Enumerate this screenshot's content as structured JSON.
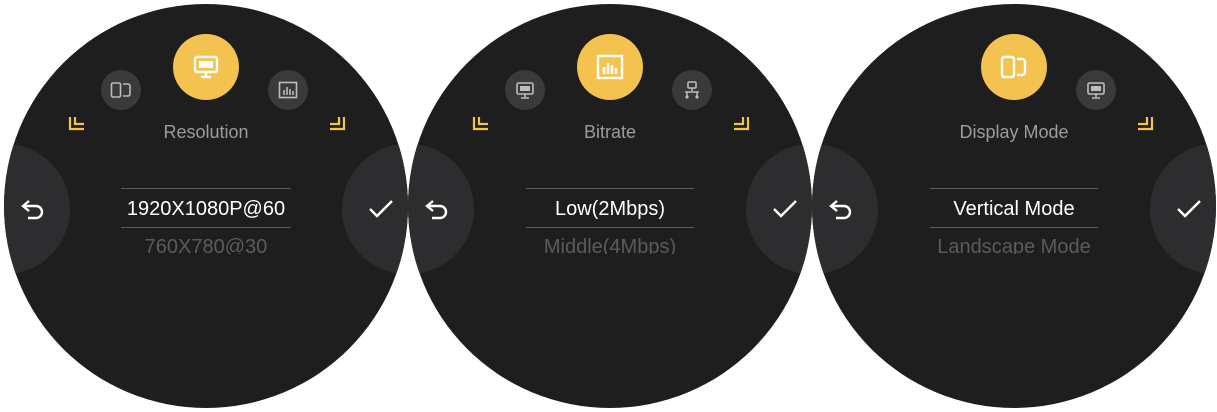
{
  "colors": {
    "accent": "#f4c24f",
    "watch_bg": "#1e1e1f",
    "side_button": "#2d2d2f"
  },
  "screens": [
    {
      "title": "Resolution",
      "selected_option": "1920X1080P@60",
      "next_option": "760X780@30",
      "icons": [
        "display-mode-icon",
        "monitor-icon",
        "bitrate-icon"
      ],
      "back_icon": "back-arrow-icon",
      "confirm_icon": "checkmark-icon"
    },
    {
      "title": "Bitrate",
      "selected_option": "Low(2Mbps)",
      "next_option": "Middle(4Mbps)",
      "icons": [
        "monitor-icon",
        "bitrate-icon",
        "network-icon"
      ],
      "back_icon": "back-arrow-icon",
      "confirm_icon": "checkmark-icon"
    },
    {
      "title": "Display Mode",
      "selected_option": "Vertical Mode",
      "next_option": "Landscape Mode",
      "icons": [
        "display-mode-icon",
        "monitor-icon"
      ],
      "back_icon": "back-arrow-icon",
      "confirm_icon": "checkmark-icon"
    }
  ]
}
